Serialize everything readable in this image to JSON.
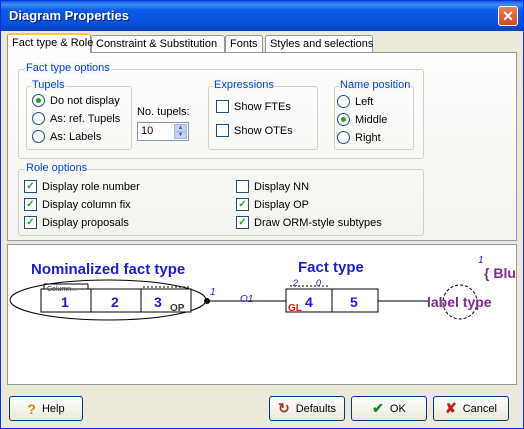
{
  "window": {
    "title": "Diagram Properties"
  },
  "tabs": [
    "Fact type & Role",
    "Constraint & Substitution",
    "Fonts",
    "Styles and selections"
  ],
  "fact_type_options": {
    "label": "Fact type options",
    "tupels": {
      "label": "Tupels",
      "options": [
        "Do not display",
        "As: ref. Tupels",
        "As: Labels"
      ],
      "selected": 0
    },
    "no_tupels": {
      "label": "No. tupels:",
      "value": "10"
    },
    "expressions": {
      "label": "Expressions",
      "items": [
        {
          "label": "Show FTEs",
          "checked": false
        },
        {
          "label": "Show OTEs",
          "checked": false
        }
      ]
    },
    "name_position": {
      "label": "Name position",
      "options": [
        "Left",
        "Middle",
        "Right"
      ],
      "selected": 1
    }
  },
  "role_options": {
    "label": "Role options",
    "left": [
      {
        "label": "Display role number",
        "checked": true
      },
      {
        "label": "Display column fix",
        "checked": true
      },
      {
        "label": "Display proposals",
        "checked": true
      }
    ],
    "right": [
      {
        "label": "Display NN",
        "checked": false
      },
      {
        "label": "Display OP",
        "checked": true
      },
      {
        "label": "Draw ORM-style subtypes",
        "checked": true
      }
    ]
  },
  "diagram": {
    "nominalized_title": "Nominalized fact type",
    "nominalized_roles": [
      "1",
      "2",
      "3"
    ],
    "column_fix_label": "Column...",
    "op_label": "OP",
    "role_number_1": "1",
    "o1_label": "O1",
    "fact_type_title": "Fact type",
    "fact_type_roles": [
      "4",
      "5"
    ],
    "role_small_numbers": [
      "2",
      "0"
    ],
    "gl_label": "GL",
    "label_type_text": "label type",
    "corner_number": "1",
    "blu_text": "{ Blu"
  },
  "buttons": {
    "help": "Help",
    "defaults": "Defaults",
    "ok": "OK",
    "cancel": "Cancel"
  },
  "colors": {
    "title_blue": "#0a5ce8",
    "diagram_blue": "#1e1ec8",
    "diagram_purple": "#7a2a8a",
    "gl_red": "#cc2200",
    "check_green": "#21a121"
  }
}
